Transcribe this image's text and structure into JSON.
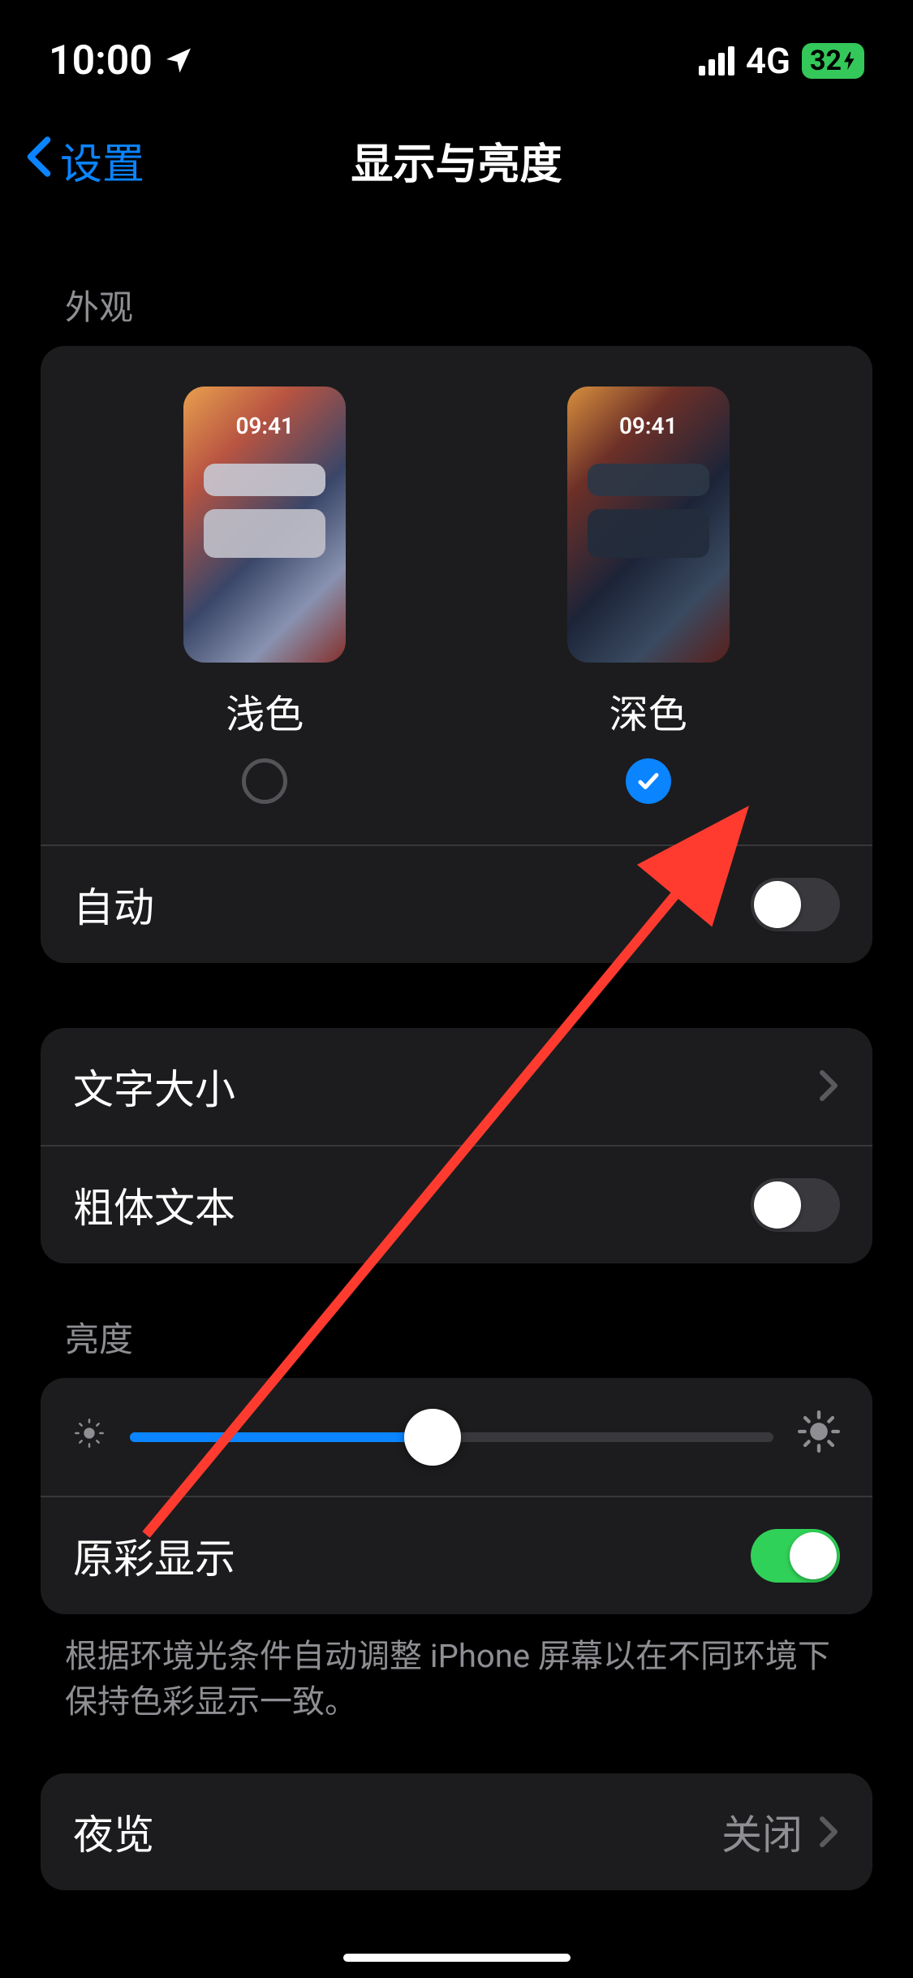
{
  "status": {
    "time": "10:00",
    "network": "4G",
    "battery_percent": "32"
  },
  "nav": {
    "back_label": "设置",
    "title": "显示与亮度"
  },
  "sections": {
    "appearance": {
      "header": "外观",
      "light_label": "浅色",
      "dark_label": "深色",
      "preview_time": "09:41",
      "selected": "dark",
      "auto_label": "自动",
      "auto_on": false
    },
    "text": {
      "size_label": "文字大小",
      "bold_label": "粗体文本",
      "bold_on": false
    },
    "brightness": {
      "header": "亮度",
      "slider_value": 0.47,
      "true_tone_label": "原彩显示",
      "true_tone_on": true,
      "footer": "根据环境光条件自动调整 iPhone 屏幕以在不同环境下保持色彩显示一致。"
    },
    "night_shift": {
      "label": "夜览",
      "value": "关闭"
    }
  },
  "colors": {
    "accent": "#0a84ff",
    "success": "#30d158",
    "annotation": "#ff3b30"
  }
}
